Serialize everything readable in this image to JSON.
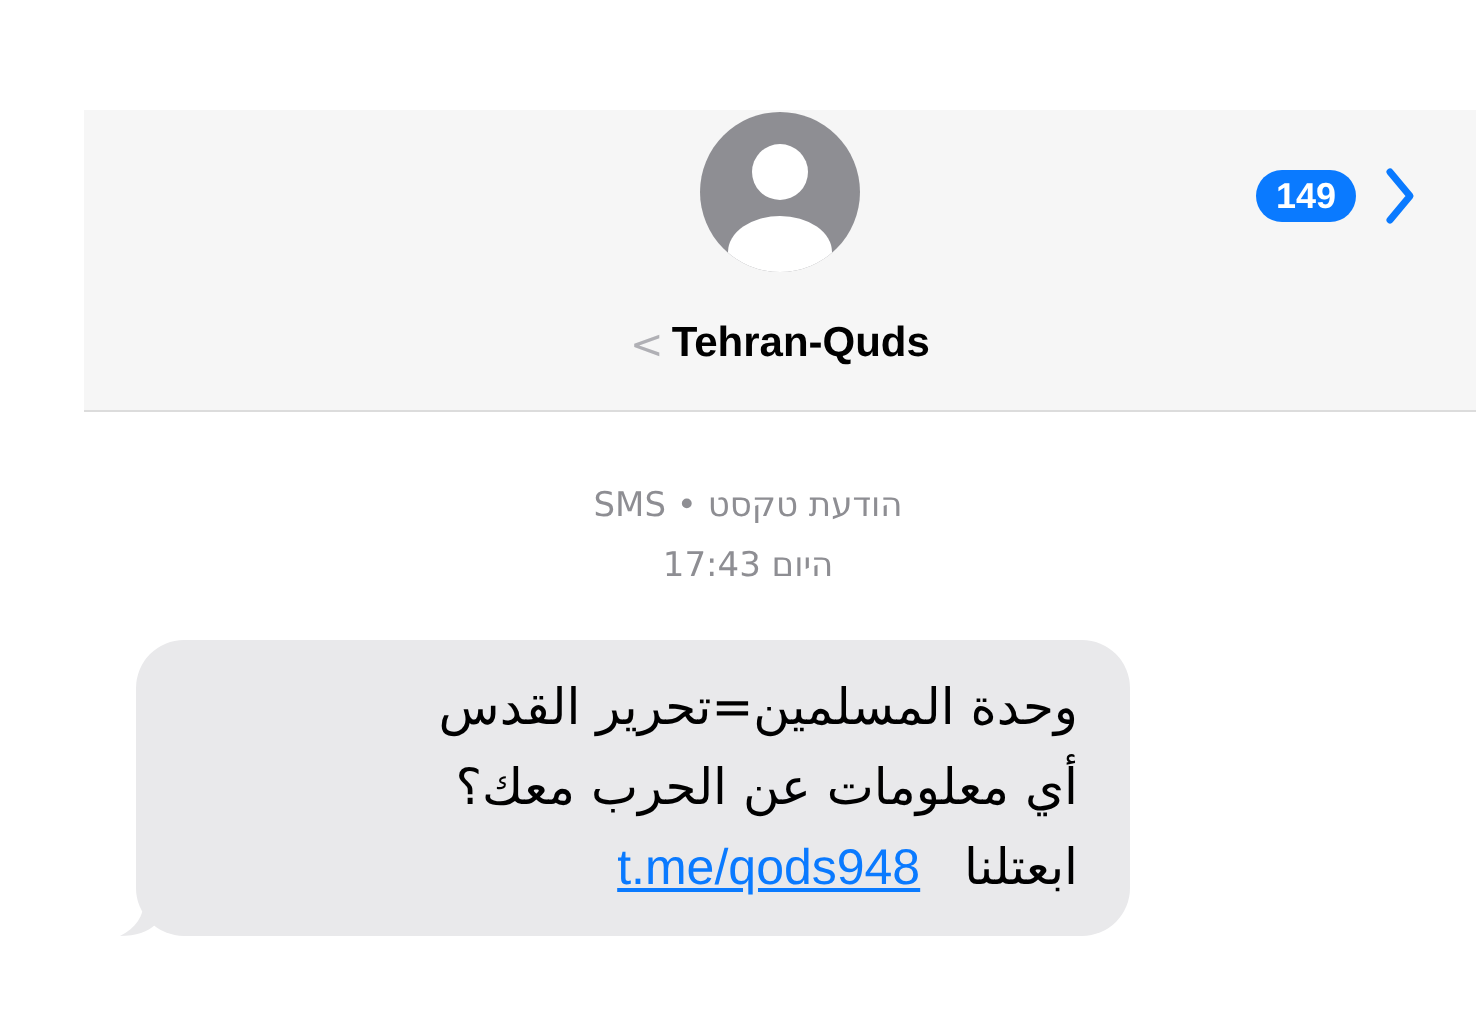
{
  "header": {
    "contact_name": "Tehran-Quds",
    "back_glyph": "<",
    "unread_count": "149"
  },
  "meta": {
    "service": "הודעת טקסט • SMS",
    "time": "היום 17:43"
  },
  "messages": [
    {
      "kind": "incoming",
      "lines": [
        "وحدة المسلمين=تحرير القدس",
        "أي معلومات عن الحرب معك؟"
      ],
      "last_line": "ابعتلنا",
      "link": "t.me/qods948"
    }
  ]
}
